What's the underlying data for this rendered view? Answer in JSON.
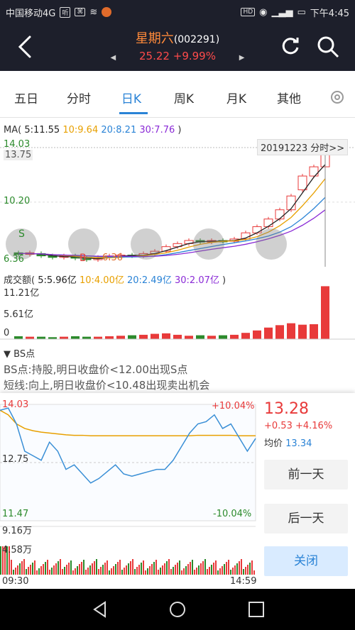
{
  "status": {
    "carrier": "中国移动4G",
    "time": "下午4:45",
    "battery": "4G"
  },
  "header": {
    "name": "星期六",
    "code": "(002291)",
    "price": "25.22",
    "change": "+9.99%"
  },
  "tabs": [
    "五日",
    "分时",
    "日K",
    "周K",
    "月K",
    "其他"
  ],
  "active_tab": "日K",
  "ma": {
    "label": "MA(",
    "ma5": "5:11.55",
    "ma10": "10:9.64",
    "ma20": "20:8.21",
    "ma30": "30:7.76",
    "close": ")"
  },
  "volume_line": {
    "label": "成交额(",
    "v5": "5:5.96亿",
    "v10": "10:4.00亿",
    "v20": "20:2.49亿",
    "v30": "30:2.07亿",
    "close": ")"
  },
  "kline_axis": {
    "top": "14.03",
    "cursor": "13.75",
    "mid": "10.20",
    "bottom": "6.36",
    "low_mark": "6.36",
    "s_mark": "S",
    "b_mark": "B"
  },
  "fenshi_button": "20191223 分时>>",
  "volume_axis": {
    "top": "11.21亿",
    "mid": "5.61亿",
    "bottom": "0"
  },
  "bs": {
    "title": "▼ BS点",
    "line1": "BS点:持股,明日收盘价<12.00出现S点",
    "line2": "短线:向上,明日收盘价<10.48出现卖出机会"
  },
  "mini": {
    "high": "14.03",
    "high_pct": "+10.04%",
    "mid": "12.75",
    "low": "11.47",
    "low_pct": "-10.04%",
    "vol_top": "9.16万",
    "vol_mid": "4.58万",
    "t_start": "09:30",
    "t_end": "14:59"
  },
  "detail": {
    "price": "13.28",
    "change": "+0.53",
    "pct": "+4.16%",
    "avg_label": "均价",
    "avg": "13.34"
  },
  "buttons": {
    "prev": "前一天",
    "next": "后一天",
    "close": "关闭"
  },
  "candles": [
    {
      "o": 6.9,
      "c": 6.8
    },
    {
      "o": 6.8,
      "c": 6.9
    },
    {
      "o": 6.85,
      "c": 6.7
    },
    {
      "o": 6.7,
      "c": 6.6
    },
    {
      "o": 6.6,
      "c": 6.7
    },
    {
      "o": 6.7,
      "c": 6.55
    },
    {
      "o": 6.55,
      "c": 6.45
    },
    {
      "o": 6.45,
      "c": 6.6
    },
    {
      "o": 6.6,
      "c": 6.7
    },
    {
      "o": 6.7,
      "c": 6.75
    },
    {
      "o": 6.75,
      "c": 6.7
    },
    {
      "o": 6.7,
      "c": 6.85
    },
    {
      "o": 6.85,
      "c": 7.0
    },
    {
      "o": 7.0,
      "c": 7.3
    },
    {
      "o": 7.3,
      "c": 7.5
    },
    {
      "o": 7.5,
      "c": 7.7
    },
    {
      "o": 7.7,
      "c": 7.6
    },
    {
      "o": 7.6,
      "c": 7.7
    },
    {
      "o": 7.7,
      "c": 7.65
    },
    {
      "o": 7.65,
      "c": 7.8
    },
    {
      "o": 7.8,
      "c": 8.2
    },
    {
      "o": 8.2,
      "c": 8.6
    },
    {
      "o": 8.6,
      "c": 9.1
    },
    {
      "o": 9.1,
      "c": 9.7
    },
    {
      "o": 9.7,
      "c": 10.6
    },
    {
      "o": 11.0,
      "c": 11.9
    },
    {
      "o": 11.9,
      "c": 12.5
    },
    {
      "o": 12.5,
      "c": 13.7
    }
  ],
  "volumes": [
    0.6,
    0.5,
    0.5,
    0.4,
    0.5,
    0.6,
    0.5,
    0.5,
    0.6,
    0.7,
    0.8,
    0.9,
    1.1,
    1.2,
    0.9,
    0.7,
    0.8,
    0.7,
    0.8,
    0.9,
    1.3,
    1.8,
    2.4,
    2.9,
    3.3,
    3.0,
    3.1,
    11.0
  ]
}
